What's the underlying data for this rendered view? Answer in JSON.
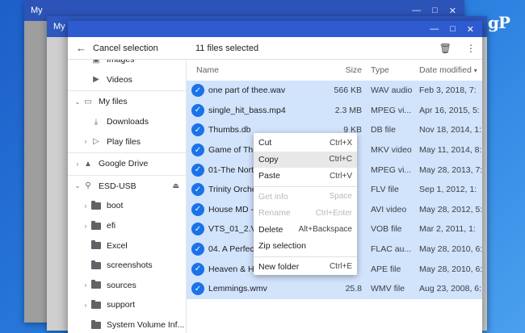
{
  "windows": {
    "bg1_title": "My",
    "bg2_title": "My"
  },
  "selection": {
    "cancel_label": "Cancel selection",
    "count_label": "11 files selected"
  },
  "sidebar": {
    "items": [
      {
        "label": "Images",
        "icon": "image-icon",
        "indent": 1,
        "expand": ""
      },
      {
        "label": "Videos",
        "icon": "video-icon",
        "indent": 1,
        "expand": ""
      },
      {
        "label": "My files",
        "icon": "laptop-icon",
        "indent": 0,
        "expand": "v"
      },
      {
        "label": "Downloads",
        "icon": "download-icon",
        "indent": 1,
        "expand": ""
      },
      {
        "label": "Play files",
        "icon": "play-icon",
        "indent": 1,
        "expand": ">"
      },
      {
        "label": "Google Drive",
        "icon": "drive-icon",
        "indent": 0,
        "expand": ">"
      },
      {
        "label": "ESD-USB",
        "icon": "usb-icon",
        "indent": 0,
        "expand": "v"
      },
      {
        "label": "boot",
        "icon": "folder-icon",
        "indent": 1,
        "expand": ">"
      },
      {
        "label": "efi",
        "icon": "folder-icon",
        "indent": 1,
        "expand": ">"
      },
      {
        "label": "Excel",
        "icon": "folder-icon",
        "indent": 1,
        "expand": ""
      },
      {
        "label": "screenshots",
        "icon": "folder-icon",
        "indent": 1,
        "expand": ""
      },
      {
        "label": "sources",
        "icon": "folder-icon",
        "indent": 1,
        "expand": ">"
      },
      {
        "label": "support",
        "icon": "folder-icon",
        "indent": 1,
        "expand": ">"
      },
      {
        "label": "System Volume Inf...",
        "icon": "folder-icon",
        "indent": 1,
        "expand": ""
      }
    ]
  },
  "columns": {
    "name": "Name",
    "size": "Size",
    "type": "Type",
    "date": "Date modified"
  },
  "files": [
    {
      "name": "one part of thee.wav",
      "size": "566 KB",
      "type": "WAV audio",
      "date": "Feb 3, 2018, 7:"
    },
    {
      "name": "single_hit_bass.mp4",
      "size": "2.3 MB",
      "type": "MPEG vi...",
      "date": "Apr 16, 2015, 5:"
    },
    {
      "name": "Thumbs.db",
      "size": "9 KB",
      "type": "DB file",
      "date": "Nov 18, 2014, 1:"
    },
    {
      "name": "Game of Thr",
      "size": "",
      "type": "MKV video",
      "date": "May 11, 2014, 8:"
    },
    {
      "name": "01-The North",
      "size": "",
      "type": "MPEG vi...",
      "date": "May 28, 2013, 7:"
    },
    {
      "name": "Trinity Orche",
      "size": "",
      "type": "FLV file",
      "date": "Sep 1, 2012, 1:"
    },
    {
      "name": "House MD - ",
      "size": "",
      "type": "AVI video",
      "date": "May 28, 2012, 5:"
    },
    {
      "name": "VTS_01_2.VC",
      "size": "",
      "type": "VOB file",
      "date": "Mar 2, 2011, 1:"
    },
    {
      "name": "04. A Perfect",
      "size": "",
      "type": "FLAC au...",
      "date": "May 28, 2010, 6:"
    },
    {
      "name": "Heaven & He",
      "size": "",
      "type": "APE file",
      "date": "May 28, 2010, 6:"
    },
    {
      "name": "Lemmings.wmv",
      "size": "25.8",
      "type": "WMV file",
      "date": "Aug 23, 2008, 6:"
    }
  ],
  "context_menu": [
    {
      "label": "Cut",
      "shortcut": "Ctrl+X",
      "disabled": false
    },
    {
      "label": "Copy",
      "shortcut": "Ctrl+C",
      "disabled": false,
      "hover": true
    },
    {
      "label": "Paste",
      "shortcut": "Ctrl+V",
      "disabled": false
    },
    {
      "sep": true
    },
    {
      "label": "Get info",
      "shortcut": "Space",
      "disabled": true
    },
    {
      "label": "Rename",
      "shortcut": "Ctrl+Enter",
      "disabled": true
    },
    {
      "label": "Delete",
      "shortcut": "Alt+Backspace",
      "disabled": false
    },
    {
      "label": "Zip selection",
      "shortcut": "",
      "disabled": false
    },
    {
      "sep": true
    },
    {
      "label": "New folder",
      "shortcut": "Ctrl+E",
      "disabled": false
    }
  ],
  "logo": "gP",
  "colors": {
    "accent": "#1a73e8",
    "selected_row": "#d2e3fc",
    "titlebar": "#2e5bd0"
  }
}
